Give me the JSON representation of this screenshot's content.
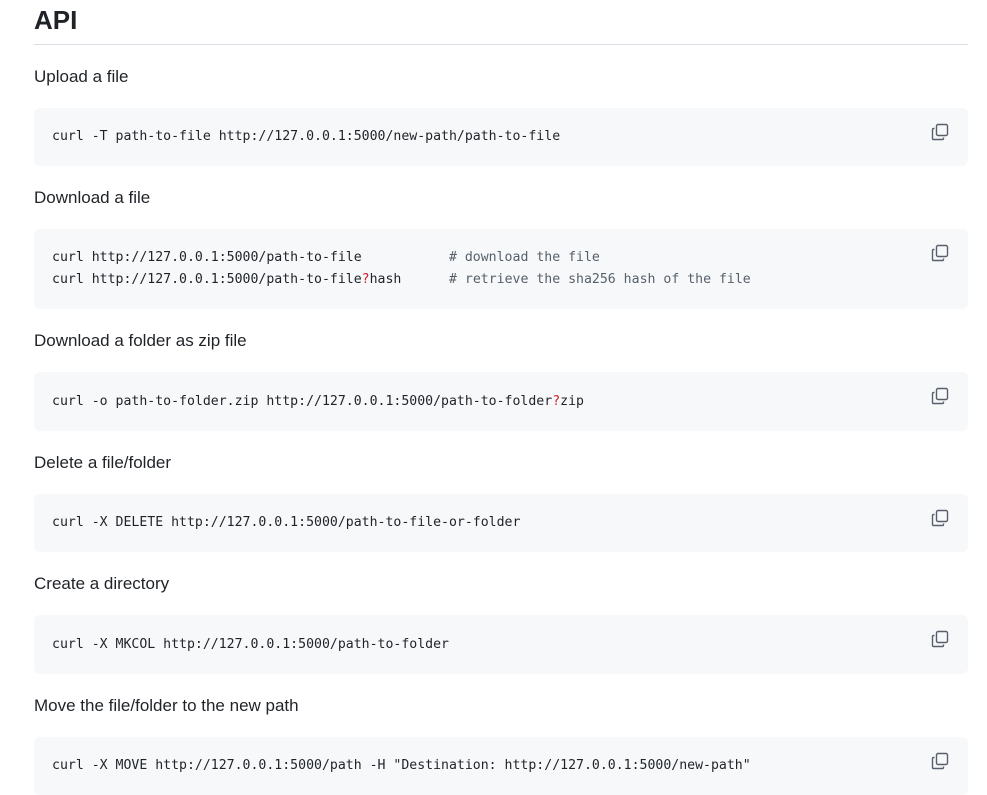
{
  "heading": "API",
  "sections": [
    {
      "label": "Upload a file",
      "lines": [
        {
          "parts": [
            {
              "t": "curl -T path-to-file http://127.0.0.1:5000/new-path/path-to-file",
              "c": ""
            }
          ]
        }
      ]
    },
    {
      "label": "Download a file",
      "lines": [
        {
          "parts": [
            {
              "t": "curl http://127.0.0.1:5000/path-to-file           ",
              "c": ""
            },
            {
              "t": "# download the file",
              "c": "cm"
            }
          ]
        },
        {
          "parts": [
            {
              "t": "curl http://127.0.0.1:5000/path-to-file",
              "c": ""
            },
            {
              "t": "?",
              "c": "op"
            },
            {
              "t": "hash      ",
              "c": ""
            },
            {
              "t": "# retrieve the sha256 hash of the file",
              "c": "cm"
            }
          ]
        }
      ]
    },
    {
      "label": "Download a folder as zip file",
      "lines": [
        {
          "parts": [
            {
              "t": "curl -o path-to-folder.zip http://127.0.0.1:5000/path-to-folder",
              "c": ""
            },
            {
              "t": "?",
              "c": "op"
            },
            {
              "t": "zip",
              "c": ""
            }
          ]
        }
      ]
    },
    {
      "label": "Delete a file/folder",
      "lines": [
        {
          "parts": [
            {
              "t": "curl -X DELETE http://127.0.0.1:5000/path-to-file-or-folder",
              "c": ""
            }
          ]
        }
      ]
    },
    {
      "label": "Create a directory",
      "lines": [
        {
          "parts": [
            {
              "t": "curl -X MKCOL http://127.0.0.1:5000/path-to-folder",
              "c": ""
            }
          ]
        }
      ]
    },
    {
      "label": "Move the file/folder to the new path",
      "lines": [
        {
          "parts": [
            {
              "t": "curl -X MOVE http://127.0.0.1:5000/path -H \"Destination: http://127.0.0.1:5000/new-path\"",
              "c": ""
            }
          ]
        }
      ]
    }
  ],
  "icons": {
    "copy": "copy-icon"
  }
}
